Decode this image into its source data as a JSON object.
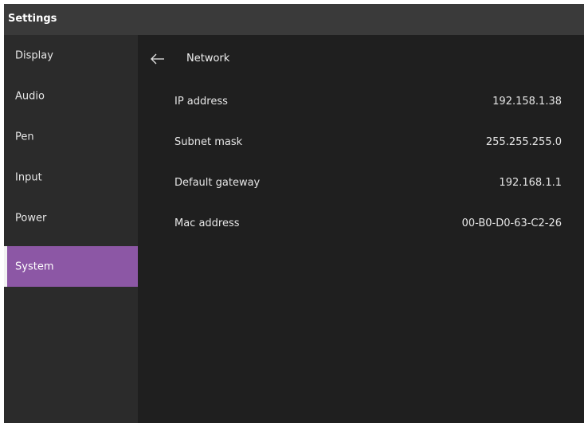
{
  "window": {
    "title": "Settings"
  },
  "sidebar": {
    "items": [
      {
        "label": "Display",
        "selected": false
      },
      {
        "label": "Audio",
        "selected": false
      },
      {
        "label": "Pen",
        "selected": false
      },
      {
        "label": "Input",
        "selected": false
      },
      {
        "label": "Power",
        "selected": false
      },
      {
        "label": "System",
        "selected": true
      }
    ]
  },
  "content": {
    "back_icon": "arrow-left-icon",
    "section_title": "Network",
    "rows": [
      {
        "key": "IP address",
        "value": "192.158.1.38"
      },
      {
        "key": "Subnet mask",
        "value": "255.255.255.0"
      },
      {
        "key": "Default gateway",
        "value": "192.168.1.1"
      },
      {
        "key": "Mac address",
        "value": "00-B0-D0-63-C2-26"
      }
    ]
  },
  "colors": {
    "titlebar": "#3a3a3a",
    "sidebar": "#2b2b2b",
    "content": "#1f1f1f",
    "accent": "#8c57a5",
    "text": "#e6e6e6"
  }
}
